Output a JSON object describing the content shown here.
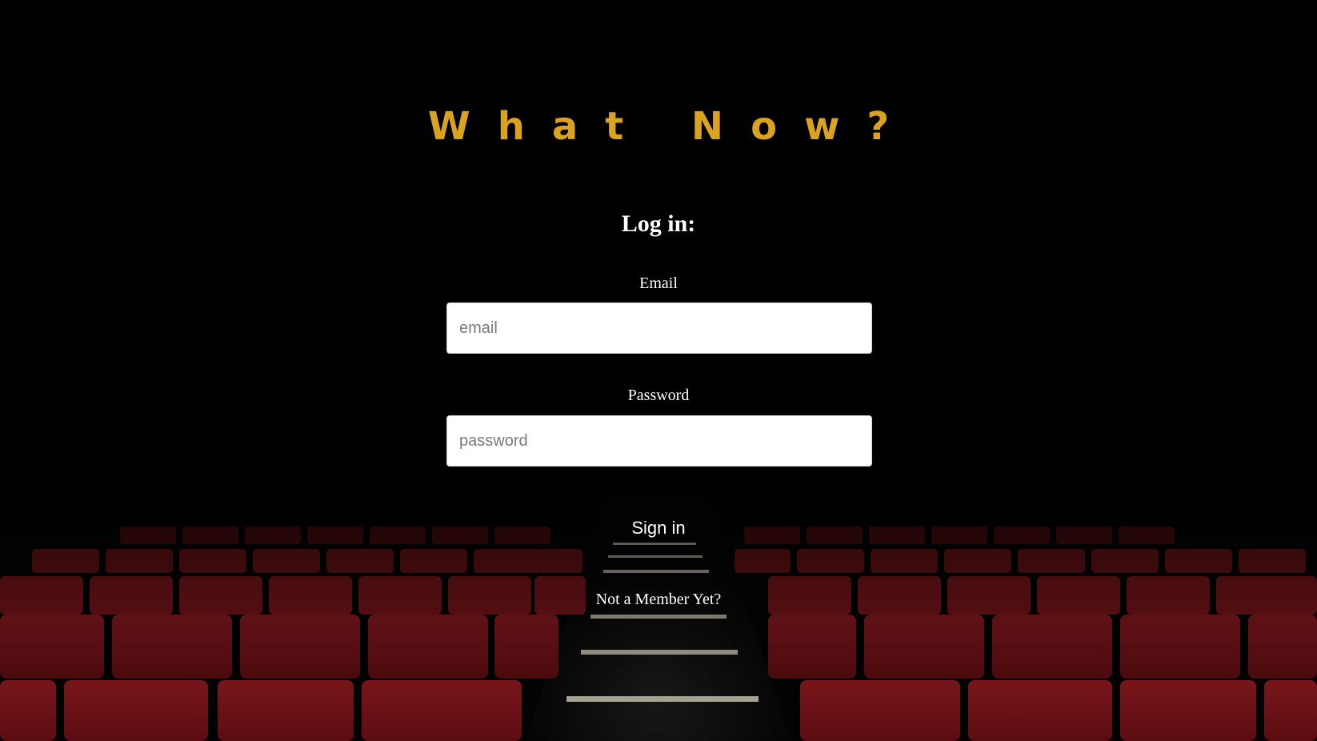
{
  "app": {
    "title": "What Now?"
  },
  "login": {
    "heading": "Log in:",
    "email_label": "Email",
    "email_placeholder": "email",
    "email_value": "",
    "password_label": "Password",
    "password_placeholder": "password",
    "password_value": "",
    "signin_label": "Sign in",
    "signup_link": "Not a Member Yet?"
  },
  "colors": {
    "title": "#d9a21f",
    "seat": "#7a1016",
    "text": "#ffffff"
  }
}
